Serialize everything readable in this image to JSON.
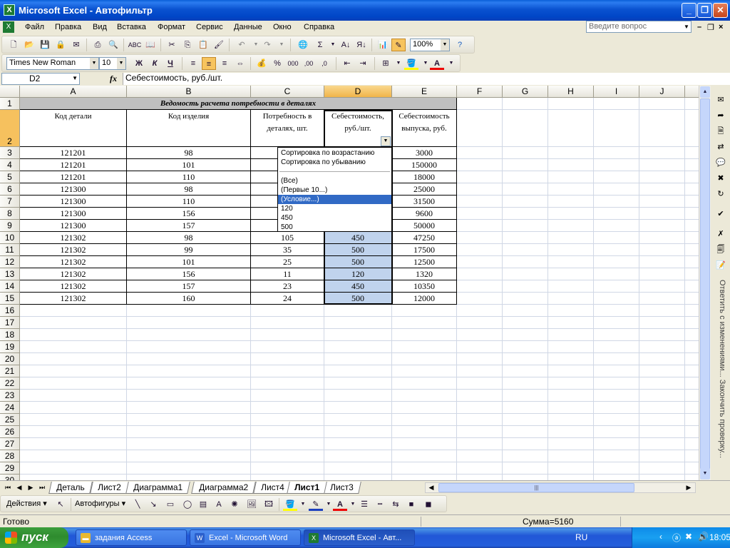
{
  "window": {
    "title": "Microsoft Excel - Автофильтр",
    "controls": [
      "_",
      "❐",
      "✕"
    ]
  },
  "menu": {
    "items": [
      "Файл",
      "Правка",
      "Вид",
      "Вставка",
      "Формат",
      "Сервис",
      "Данные",
      "Окно",
      "Справка"
    ],
    "ask_placeholder": "Введите вопрос"
  },
  "toolbar_standard": {
    "zoom": "100%"
  },
  "toolbar_format": {
    "font": "Times New Roman",
    "size": "10",
    "bold": "Ж",
    "italic": "К",
    "underline": "Ч",
    "percent": "%",
    "thousands": "000",
    "dec_inc": ",00",
    "dec_dec": ",0"
  },
  "formula_bar": {
    "name_box": "D2",
    "fx": "fx",
    "content": "Себестоимость, руб./шт."
  },
  "columns": [
    "A",
    "B",
    "C",
    "D",
    "E",
    "F",
    "G",
    "H",
    "I",
    "J"
  ],
  "rows": [
    "1",
    "2",
    "3",
    "4",
    "5",
    "6",
    "7",
    "8",
    "9",
    "10",
    "11",
    "12",
    "13",
    "14",
    "15",
    "16",
    "17",
    "18",
    "19",
    "20",
    "21",
    "22",
    "23",
    "24",
    "25",
    "26",
    "27",
    "28",
    "29",
    "30"
  ],
  "table": {
    "title": "Ведомость расчета потребности в деталях",
    "headers": [
      "Код детали",
      "Код изделия",
      "Потребность в деталях, шт.",
      "Себестоимость, руб./шт.",
      "Себестоимость выпуска, руб."
    ],
    "data": [
      [
        "121201",
        "98",
        "",
        "",
        "3000"
      ],
      [
        "121201",
        "101",
        "",
        "",
        "150000"
      ],
      [
        "121201",
        "110",
        "",
        "",
        "18000"
      ],
      [
        "121300",
        "98",
        "",
        "",
        "25000"
      ],
      [
        "121300",
        "110",
        "",
        "",
        "31500"
      ],
      [
        "121300",
        "156",
        "",
        "",
        "9600"
      ],
      [
        "121300",
        "157",
        "",
        "",
        "50000"
      ],
      [
        "121302",
        "98",
        "105",
        "450",
        "47250"
      ],
      [
        "121302",
        "99",
        "35",
        "500",
        "17500"
      ],
      [
        "121302",
        "101",
        "25",
        "500",
        "12500"
      ],
      [
        "121302",
        "156",
        "11",
        "120",
        "1320"
      ],
      [
        "121302",
        "157",
        "23",
        "450",
        "10350"
      ],
      [
        "121302",
        "160",
        "24",
        "500",
        "12000"
      ]
    ]
  },
  "autofilter": {
    "sort": [
      "Сортировка по возрастанию",
      "Сортировка по убыванию"
    ],
    "options": [
      "(Все)",
      "(Первые 10...)",
      "(Условие...)",
      "120",
      "450",
      "500"
    ],
    "highlighted": "(Условие...)"
  },
  "task_pane_text": "Ответить с изменениями... Закончить проверку...",
  "sheet_tabs": [
    "Деталь",
    "Лист2",
    "Диаграмма1",
    "Диаграмма2",
    "Лист4",
    "Лист1",
    "Лист3"
  ],
  "active_sheet": "Лист1",
  "drawing_toolbar": {
    "actions": "Действия",
    "autoshapes": "Автофигуры"
  },
  "status": {
    "ready": "Готово",
    "sum": "Сумма=5160"
  },
  "taskbar": {
    "start": "пуск",
    "tasks": [
      "задания Access",
      "Excel - Microsoft Word",
      "Microsoft Excel - Авт..."
    ],
    "lang": "RU",
    "clock": "18:05"
  },
  "colors": {
    "selection_blue": "#c0d3ed",
    "menu_highlight": "#316ac5",
    "xp_title": "#0a52d0",
    "start_green": "#2e8b2e"
  }
}
